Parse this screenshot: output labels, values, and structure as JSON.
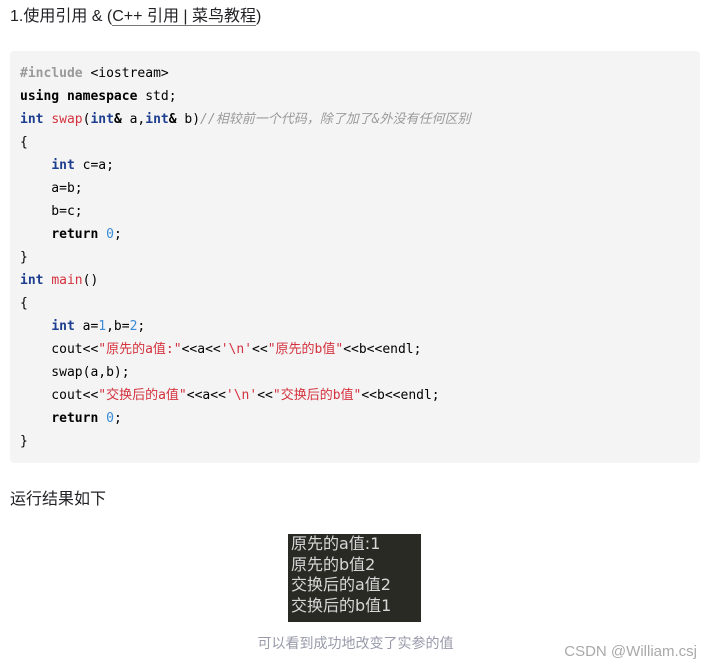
{
  "heading": {
    "prefix": "1.使用引用 & (",
    "link_text": "C++ 引用 | 菜鸟教程",
    "suffix": ")"
  },
  "code": {
    "lines": [
      [
        {
          "t": "pp",
          "v": "#include"
        },
        {
          "t": "",
          "v": " <iostream>"
        }
      ],
      [
        {
          "t": "kw2",
          "v": "using namespace"
        },
        {
          "t": "",
          "v": " std;"
        }
      ],
      [
        {
          "t": "kw",
          "v": "int"
        },
        {
          "t": "",
          "v": " "
        },
        {
          "t": "fn",
          "v": "swap"
        },
        {
          "t": "",
          "v": "("
        },
        {
          "t": "kw",
          "v": "int"
        },
        {
          "t": "kw2",
          "v": "&"
        },
        {
          "t": "",
          "v": " a,"
        },
        {
          "t": "kw",
          "v": "int"
        },
        {
          "t": "kw2",
          "v": "&"
        },
        {
          "t": "",
          "v": " b)"
        },
        {
          "t": "cm",
          "v": "//相较前一个代码，除了加了&外没有任何区别"
        }
      ],
      [
        {
          "t": "",
          "v": "{"
        }
      ],
      [
        {
          "t": "",
          "v": "    "
        },
        {
          "t": "kw",
          "v": "int"
        },
        {
          "t": "",
          "v": " c=a;"
        }
      ],
      [
        {
          "t": "",
          "v": "    a=b;"
        }
      ],
      [
        {
          "t": "",
          "v": "    b=c;"
        }
      ],
      [
        {
          "t": "",
          "v": "    "
        },
        {
          "t": "ret",
          "v": "return"
        },
        {
          "t": "",
          "v": " "
        },
        {
          "t": "num",
          "v": "0"
        },
        {
          "t": "",
          "v": ";"
        }
      ],
      [
        {
          "t": "",
          "v": "}"
        }
      ],
      [
        {
          "t": "kw",
          "v": "int"
        },
        {
          "t": "",
          "v": " "
        },
        {
          "t": "fn",
          "v": "main"
        },
        {
          "t": "",
          "v": "()"
        }
      ],
      [
        {
          "t": "",
          "v": "{"
        }
      ],
      [
        {
          "t": "",
          "v": "    "
        },
        {
          "t": "kw",
          "v": "int"
        },
        {
          "t": "",
          "v": " a="
        },
        {
          "t": "num",
          "v": "1"
        },
        {
          "t": "",
          "v": ",b="
        },
        {
          "t": "num",
          "v": "2"
        },
        {
          "t": "",
          "v": ";"
        }
      ],
      [
        {
          "t": "",
          "v": "    cout<<"
        },
        {
          "t": "str",
          "v": "\"原先的a值:\""
        },
        {
          "t": "",
          "v": "<<a<<"
        },
        {
          "t": "str",
          "v": "'\\n'"
        },
        {
          "t": "",
          "v": "<<"
        },
        {
          "t": "str",
          "v": "\"原先的b值\""
        },
        {
          "t": "",
          "v": "<<b<<endl;"
        }
      ],
      [
        {
          "t": "",
          "v": "    swap(a,b);"
        }
      ],
      [
        {
          "t": "",
          "v": "    cout<<"
        },
        {
          "t": "str",
          "v": "\"交换后的a值\""
        },
        {
          "t": "",
          "v": "<<a<<"
        },
        {
          "t": "str",
          "v": "'\\n'"
        },
        {
          "t": "",
          "v": "<<"
        },
        {
          "t": "str",
          "v": "\"交换后的b值\""
        },
        {
          "t": "",
          "v": "<<b<<endl;"
        }
      ],
      [
        {
          "t": "",
          "v": "    "
        },
        {
          "t": "ret",
          "v": "return"
        },
        {
          "t": "",
          "v": " "
        },
        {
          "t": "num",
          "v": "0"
        },
        {
          "t": "",
          "v": ";"
        }
      ],
      [
        {
          "t": "",
          "v": "}"
        }
      ]
    ]
  },
  "result_label": "运行结果如下",
  "console_output": [
    "原先的a值:1",
    "原先的b值2",
    "交换后的a值2",
    "交换后的b值1"
  ],
  "caption": "可以看到成功地改变了实参的值",
  "watermark": "CSDN @William.csj"
}
